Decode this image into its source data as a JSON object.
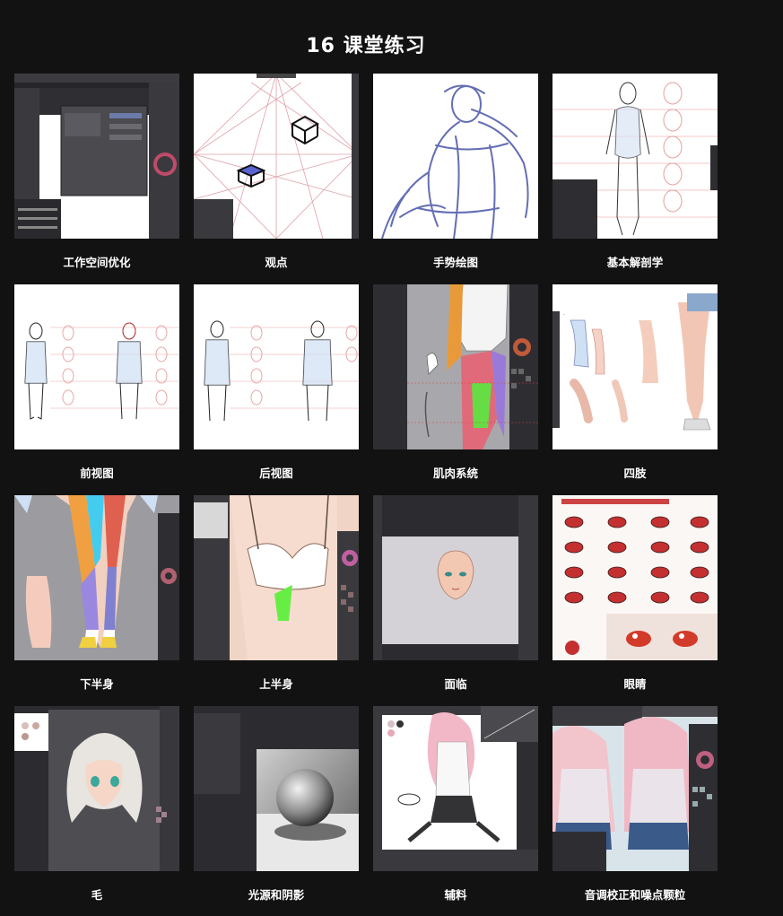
{
  "page": {
    "title": "16 课堂练习"
  },
  "lessons": [
    {
      "label": "工作空间优化",
      "thumb_icon": "workspace-ui-thumbnail"
    },
    {
      "label": "观点",
      "thumb_icon": "perspective-grid-thumbnail"
    },
    {
      "label": "手势绘图",
      "thumb_icon": "gesture-sketch-thumbnail"
    },
    {
      "label": "基本解剖学",
      "thumb_icon": "anatomy-figure-thumbnail"
    },
    {
      "label": "前视图",
      "thumb_icon": "front-view-figure-thumbnail"
    },
    {
      "label": "后视图",
      "thumb_icon": "back-view-figure-thumbnail"
    },
    {
      "label": "肌肉系统",
      "thumb_icon": "muscle-system-thumbnail"
    },
    {
      "label": "四肢",
      "thumb_icon": "limbs-thumbnail"
    },
    {
      "label": "下半身",
      "thumb_icon": "lower-body-thumbnail"
    },
    {
      "label": "上半身",
      "thumb_icon": "upper-body-thumbnail"
    },
    {
      "label": "面临",
      "thumb_icon": "face-thumbnail"
    },
    {
      "label": "眼睛",
      "thumb_icon": "eyes-thumbnail"
    },
    {
      "label": "毛",
      "thumb_icon": "hair-thumbnail"
    },
    {
      "label": "光源和阴影",
      "thumb_icon": "light-shadow-sphere-thumbnail"
    },
    {
      "label": "辅料",
      "thumb_icon": "accessories-thumbnail"
    },
    {
      "label": "音调校正和噪点颗粒",
      "thumb_icon": "tone-correction-thumbnail"
    }
  ],
  "colors": {
    "background": "#121212",
    "text": "#ffffff"
  }
}
